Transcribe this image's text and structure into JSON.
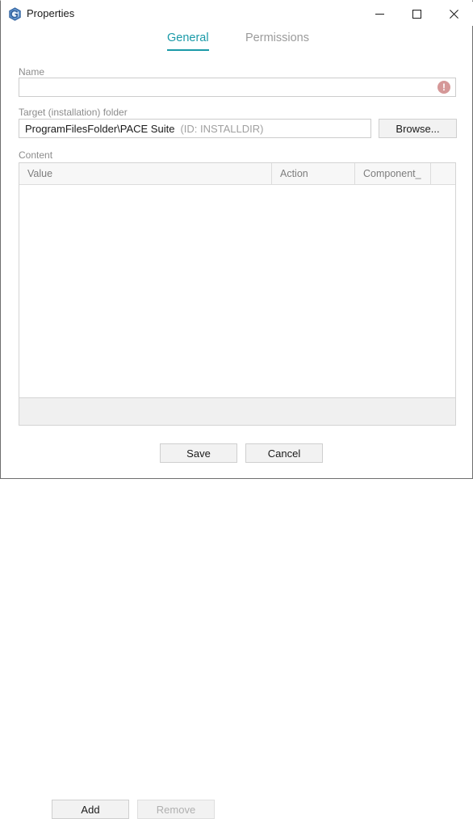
{
  "window": {
    "title": "Properties",
    "icon": "app-hexagon-icon",
    "controls": {
      "minimize": "minimize-icon",
      "maximize": "maximize-icon",
      "close": "close-icon"
    }
  },
  "tabs": [
    {
      "label": "General",
      "active": true
    },
    {
      "label": "Permissions",
      "active": false
    }
  ],
  "form": {
    "name": {
      "label": "Name",
      "value": "",
      "placeholder": "",
      "error_icon": "error-exclamation-icon",
      "has_error": true
    },
    "target_folder": {
      "label": "Target (installation) folder",
      "path": "ProgramFilesFolder\\PACE Suite",
      "id_text": "(ID: INSTALLDIR)",
      "browse_label": "Browse..."
    },
    "content": {
      "label": "Content",
      "columns": [
        "Value",
        "Action",
        "Component_",
        ""
      ],
      "rows": [],
      "add_label": "Add",
      "remove_label": "Remove",
      "remove_enabled": false
    }
  },
  "footer": {
    "save_label": "Save",
    "cancel_label": "Cancel"
  },
  "colors": {
    "accent": "#1a9aa8",
    "error": "#d59898",
    "text": "#1a1a1a",
    "label": "#8c8c8c",
    "border": "#cccccc",
    "panel": "#f0f0f0"
  }
}
